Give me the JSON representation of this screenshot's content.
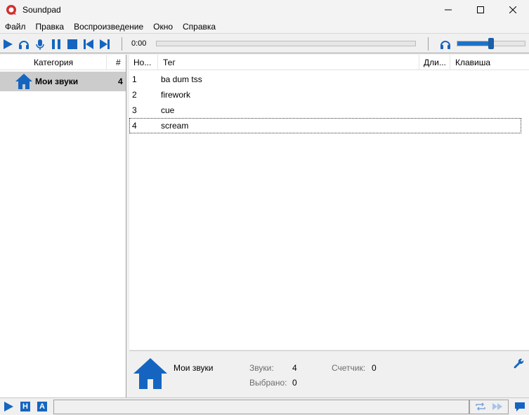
{
  "window": {
    "title": "Soundpad",
    "accent": "#1565c0"
  },
  "menu": [
    "Файл",
    "Правка",
    "Воспроизведение",
    "Окно",
    "Справка"
  ],
  "toolbar": {
    "time": "0:00",
    "volume_fraction": 0.5
  },
  "sidebar": {
    "col_category": "Категория",
    "col_count": "#",
    "categories": [
      {
        "label": "Мои звуки",
        "count": "4",
        "icon": "home-icon"
      }
    ]
  },
  "list": {
    "columns": [
      "Но...",
      "Тег",
      "Дли...",
      "Клавиша"
    ],
    "rows": [
      {
        "num": "1",
        "tag": "ba dum tss"
      },
      {
        "num": "2",
        "tag": "firework"
      },
      {
        "num": "3",
        "tag": "cue"
      },
      {
        "num": "4",
        "tag": "scream"
      }
    ]
  },
  "info": {
    "name": "Мои звуки",
    "sounds_label": "Звуки:",
    "sounds_value": "4",
    "counter_label": "Счетчик:",
    "counter_value": "0",
    "selected_label": "Выбрано:",
    "selected_value": "0"
  },
  "status": {
    "n_letter": "Н",
    "a_letter": "A"
  }
}
